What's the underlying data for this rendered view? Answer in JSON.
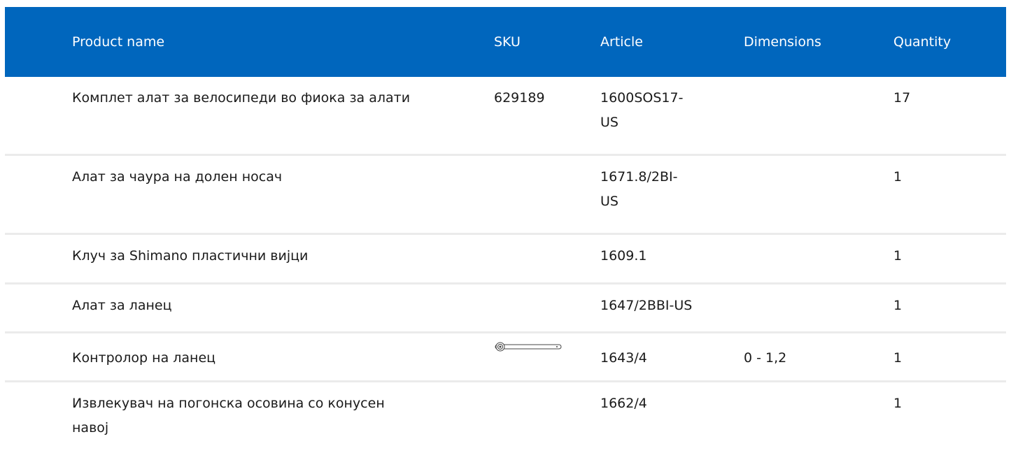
{
  "headers": {
    "name": "Product name",
    "sku": "SKU",
    "article": "Article",
    "dimensions": "Dimensions",
    "quantity": "Quantity"
  },
  "rows": [
    {
      "name": "Комплет алат за велосипеди во фиока за алати",
      "sku": "629189",
      "article": "1600SOS17-US",
      "dimensions": "",
      "quantity": "17"
    },
    {
      "name": "Алат за чаура на долен носач",
      "sku": "",
      "article": "1671.8/2BI-US",
      "dimensions": "",
      "quantity": "1"
    },
    {
      "name": "Клуч за Shimano пластични вијци",
      "sku": "",
      "article": "1609.1",
      "dimensions": "",
      "quantity": "1"
    },
    {
      "name": "Алат за ланец",
      "sku": "",
      "article": "1647/2BBI-US",
      "dimensions": "",
      "quantity": "1"
    },
    {
      "name": "Контролор на ланец",
      "sku": "",
      "sku_icon": "chain-checker-tool-icon",
      "article": "1643/4",
      "dimensions": "0 - 1,2",
      "quantity": "1"
    },
    {
      "name": "Извлекувач на погонска осовина со конусен навој",
      "sku": "",
      "article": "1662/4",
      "dimensions": "",
      "quantity": "1"
    }
  ]
}
